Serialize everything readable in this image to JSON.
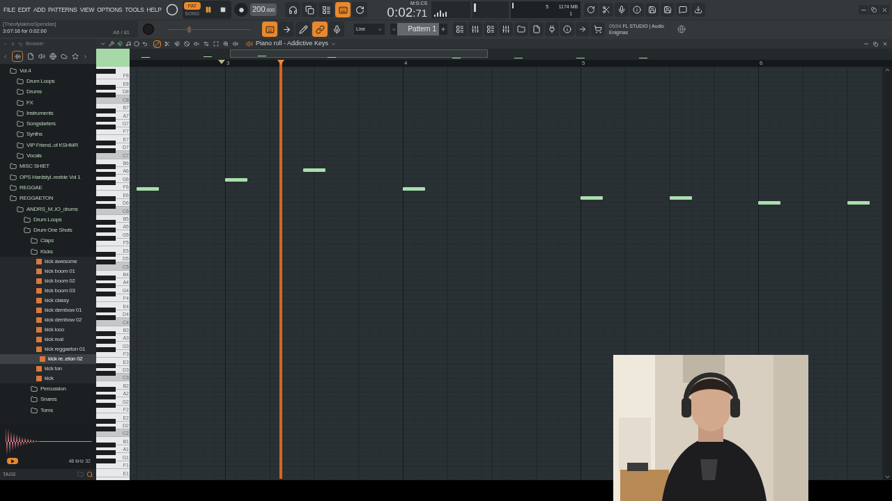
{
  "menu": [
    "FILE",
    "EDIT",
    "ADD",
    "PATTERNS",
    "VIEW",
    "OPTIONS",
    "TOOLS",
    "HELP"
  ],
  "hint": {
    "title": "[TheofylaktosSpendas]",
    "text": "3:07:16 for 0:02:00",
    "position": "A6 / 81"
  },
  "transport": {
    "modes": [
      {
        "label": "PAT",
        "selected": true
      },
      {
        "label": "SONG",
        "selected": false
      }
    ],
    "playing": true,
    "tempo": "200",
    "tempo_fraction": ".000"
  },
  "toggles_top": [
    {
      "on": false
    },
    {
      "on": false
    },
    {
      "on": false
    },
    {
      "on": true
    },
    {
      "on": false
    }
  ],
  "toggles_bottom": [
    {
      "on": true
    },
    {
      "on": false
    },
    {
      "on": false
    },
    {
      "on": true
    },
    {
      "on": false
    }
  ],
  "time": {
    "units": "M:S:CS",
    "value": "0:02",
    "centis": ":71"
  },
  "monitor": {
    "polyphony": "5",
    "memory": "1174 MB",
    "cores": "1"
  },
  "pitch_slider": {
    "level": 0.25
  },
  "snap": {
    "value": "Line"
  },
  "pattern": {
    "name": "Pattern 1"
  },
  "news": {
    "date": "05/04",
    "text": "FL STUDIO | Audio Enigmas"
  },
  "browser": {
    "title": "Browser",
    "tree": [
      {
        "label": "Vol.4",
        "kind": "folder",
        "selected": false,
        "children": [
          {
            "label": "Drum Loops",
            "kind": "folder",
            "selected": false
          },
          {
            "label": "Drums",
            "kind": "folder",
            "selected": false
          },
          {
            "label": "FX",
            "kind": "folder",
            "selected": false
          },
          {
            "label": "Instruments",
            "kind": "folder",
            "selected": false
          },
          {
            "label": "Songstarters",
            "kind": "folder",
            "selected": false
          },
          {
            "label": "Synths",
            "kind": "folder",
            "selected": false
          },
          {
            "label": "VIP Friend..of KSHMR",
            "kind": "folder",
            "selected": false
          },
          {
            "label": "Vocals",
            "kind": "folder",
            "selected": false
          }
        ]
      },
      {
        "label": "MISC SHIET",
        "kind": "folder",
        "selected": false
      },
      {
        "label": "OPS Hardstyl..reebie Vol 1",
        "kind": "folder",
        "selected": false
      },
      {
        "label": "REGGAE",
        "kind": "folder",
        "selected": false
      },
      {
        "label": "REGGAETON",
        "kind": "folder",
        "selected": false,
        "children": [
          {
            "label": "ANDRS_M..IO_drums",
            "kind": "folder",
            "selected": false,
            "children": [
              {
                "label": "Drum Loops",
                "kind": "folder",
                "selected": false
              },
              {
                "label": "Drum One Shots",
                "kind": "folder",
                "selected": false,
                "children": [
                  {
                    "label": "Claps",
                    "kind": "folder",
                    "selected": false
                  },
                  {
                    "label": "Kicks",
                    "kind": "folder",
                    "selected": false,
                    "children": [
                      {
                        "label": "kick awesome",
                        "kind": "file",
                        "selected": false
                      },
                      {
                        "label": "kick boom 01",
                        "kind": "file",
                        "selected": false
                      },
                      {
                        "label": "kick boom 02",
                        "kind": "file",
                        "selected": false
                      },
                      {
                        "label": "kick boom 03",
                        "kind": "file",
                        "selected": false
                      },
                      {
                        "label": "kick classy",
                        "kind": "file",
                        "selected": false
                      },
                      {
                        "label": "kick dembow 01",
                        "kind": "file",
                        "selected": false
                      },
                      {
                        "label": "kick dembow 02",
                        "kind": "file",
                        "selected": false
                      },
                      {
                        "label": "kick loco",
                        "kind": "file",
                        "selected": false
                      },
                      {
                        "label": "kick real",
                        "kind": "file",
                        "selected": false
                      },
                      {
                        "label": "kick reggaeton 01",
                        "kind": "file",
                        "selected": false
                      },
                      {
                        "label": "kick re..eton 02",
                        "kind": "file",
                        "selected": true
                      },
                      {
                        "label": "kick ton",
                        "kind": "file",
                        "selected": false
                      },
                      {
                        "label": "kick",
                        "kind": "file",
                        "selected": false
                      }
                    ]
                  },
                  {
                    "label": "Percussion",
                    "kind": "folder",
                    "selected": false
                  },
                  {
                    "label": "Snares",
                    "kind": "folder",
                    "selected": false
                  },
                  {
                    "label": "Toms",
                    "kind": "folder",
                    "selected": false
                  }
                ]
              }
            ]
          }
        ]
      }
    ],
    "sample_info": "48 kHz 32",
    "tags": "TAGS"
  },
  "piano_roll": {
    "title": "Piano roll - Addictive Keys",
    "tools": [
      {
        "selected": true
      },
      {
        "selected": false
      },
      {
        "selected": false
      },
      {
        "selected": false
      },
      {
        "selected": false
      },
      {
        "selected": false
      },
      {
        "selected": false
      },
      {
        "selected": false
      },
      {
        "selected": false
      }
    ],
    "bars": [
      "3",
      "4",
      "5",
      "6"
    ],
    "keys": [
      "F8",
      "E8",
      "D8",
      "C8",
      "B7",
      "A7",
      "G7",
      "F7",
      "E7",
      "D7",
      "C7",
      "B6",
      "A6",
      "G6",
      "F6",
      "E6",
      "D6",
      "C6",
      "B5",
      "A5",
      "G5",
      "F5",
      "E5",
      "D5",
      "C5",
      "B4",
      "A4",
      "G4",
      "F4",
      "E4",
      "D4",
      "C4",
      "B3",
      "A3",
      "G3",
      "F3",
      "E3",
      "D3",
      "C3",
      "B2",
      "A2",
      "G2",
      "F2",
      "E2",
      "D2",
      "C2",
      "B1",
      "A1",
      "G1",
      "F1",
      "E1"
    ]
  }
}
